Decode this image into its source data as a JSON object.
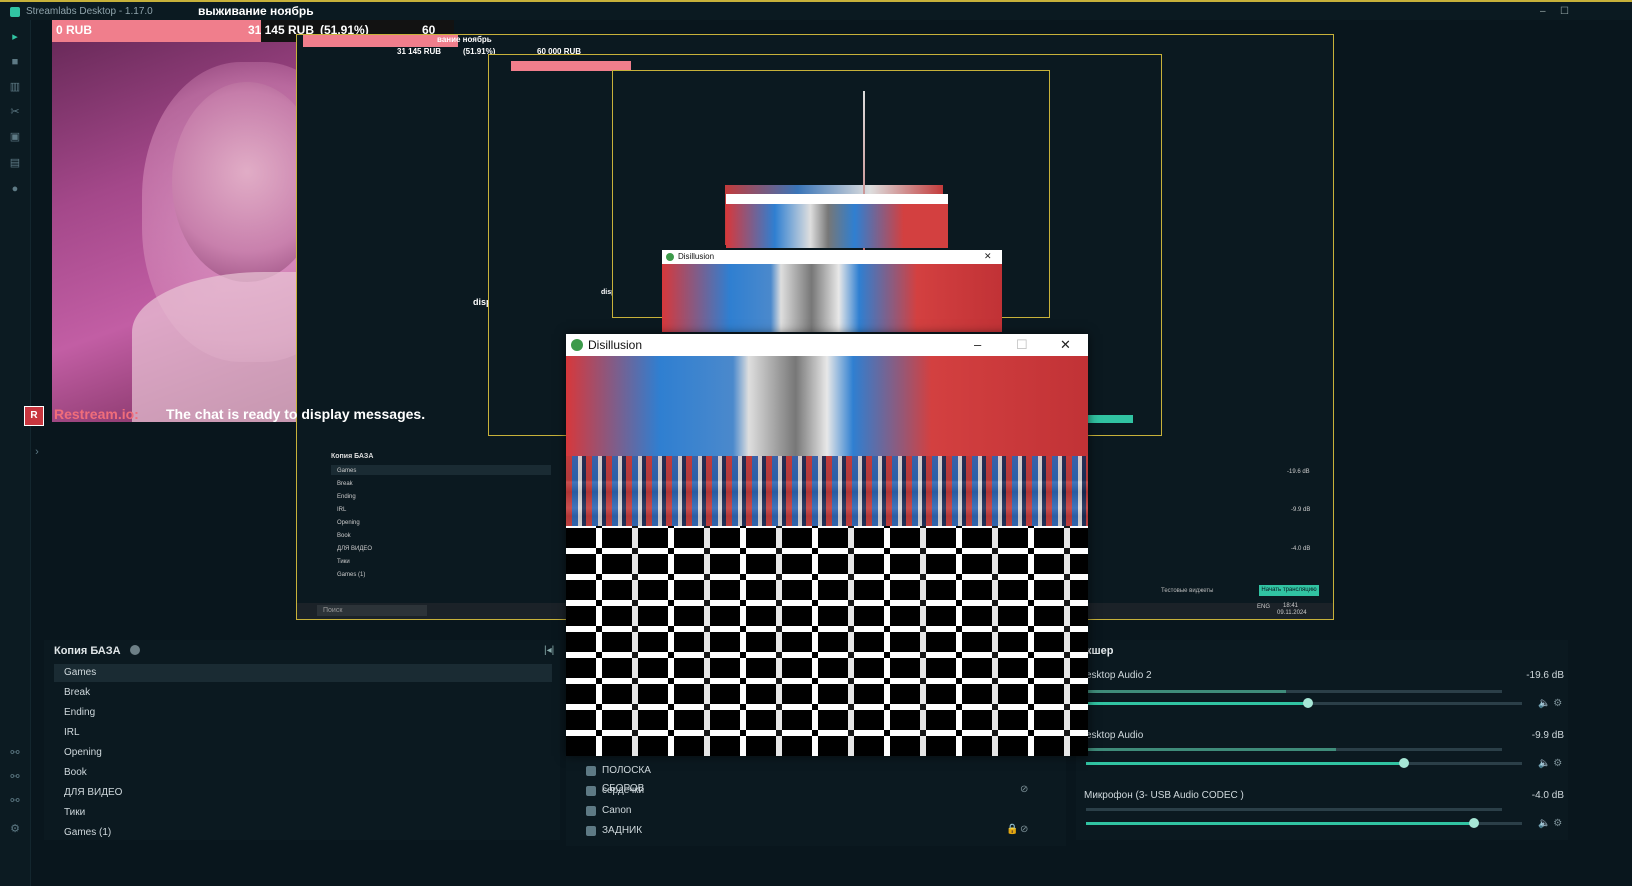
{
  "app": {
    "title": "Streamlabs Desktop - 1.17.0"
  },
  "goal": {
    "title": "выживание ноябрь",
    "start": "0 RUB",
    "current": "31 145 RUB",
    "percent": "(51.91%)",
    "target": "60 000 RUB",
    "progress_fraction": 0.5191,
    "fill_color": "#f07e8c"
  },
  "chat": {
    "badge": "R",
    "user": "Restream.io:",
    "message": "The chat is ready to display messages."
  },
  "leftnav": {
    "icons": [
      "editor-icon",
      "layout-icon",
      "columns-icon",
      "tools-icon",
      "store-icon",
      "media-icon",
      "circle-icon"
    ],
    "bottom_icons": [
      "link-icon",
      "link-icon",
      "link-icon",
      "gear-icon"
    ]
  },
  "scenes": {
    "title": "Копия БАЗА",
    "items": [
      {
        "label": "Games",
        "active": true
      },
      {
        "label": "Break",
        "active": false
      },
      {
        "label": "Ending",
        "active": false
      },
      {
        "label": "IRL",
        "active": false
      },
      {
        "label": "Opening",
        "active": false
      },
      {
        "label": "Book",
        "active": false
      },
      {
        "label": "ДЛЯ ВИДЕО",
        "active": false
      },
      {
        "label": "Тики",
        "active": false
      },
      {
        "label": "Games (1)",
        "active": false
      }
    ]
  },
  "sources": {
    "items": [
      {
        "label": "ПОЛОСКА СБОРОВ",
        "icon": "globe-icon"
      },
      {
        "label": "сердечки",
        "icon": "image-icon"
      },
      {
        "label": "Canon",
        "icon": "camera-icon"
      },
      {
        "label": "ЗАДНИК",
        "icon": "image-icon"
      }
    ]
  },
  "mixer": {
    "title": "кшер",
    "channels": [
      {
        "name": "esktop Audio 2",
        "db": "-19.6 dB",
        "level": 0.48,
        "volume": 0.51
      },
      {
        "name": "esktop Audio",
        "db": "-9.9 dB",
        "level": 0.6,
        "volume": 0.73
      },
      {
        "name": "Микрофон (3- USB Audio CODEC )",
        "db": "-4.0 dB",
        "level": 0.0,
        "volume": 0.89
      }
    ]
  },
  "disillusion": {
    "title": "Disillusion",
    "minimize": "–",
    "maximize": "☐",
    "close": "✕"
  },
  "nested": {
    "window_title": "Disillusion",
    "goal_title": "вание ноябрь",
    "goal_start": "RUB",
    "goal_current": "31 145 RUB",
    "goal_pct": "(51.91%)",
    "goal_target": "60 000 RUB",
    "chat_fragment": "display messages.",
    "chat_fragment2": "display messages.",
    "scenes_title": "Копия БАЗА",
    "scene_items": [
      "Games",
      "Break",
      "Ending",
      "IRL",
      "Opening",
      "Book",
      "ДЛЯ ВИДЕО",
      "Тики",
      "Games (1)"
    ],
    "search_placeholder": "Поиск",
    "test_widgets": "Тестовые виджеты",
    "start_stream": "Начать трансляцию",
    "mixer_db": [
      "-19.6 dB",
      "-9.9 dB",
      "-4.0 dB"
    ],
    "taskbar_lang": "ENG",
    "taskbar_time": "18:41",
    "taskbar_date": "09.11.2024"
  }
}
